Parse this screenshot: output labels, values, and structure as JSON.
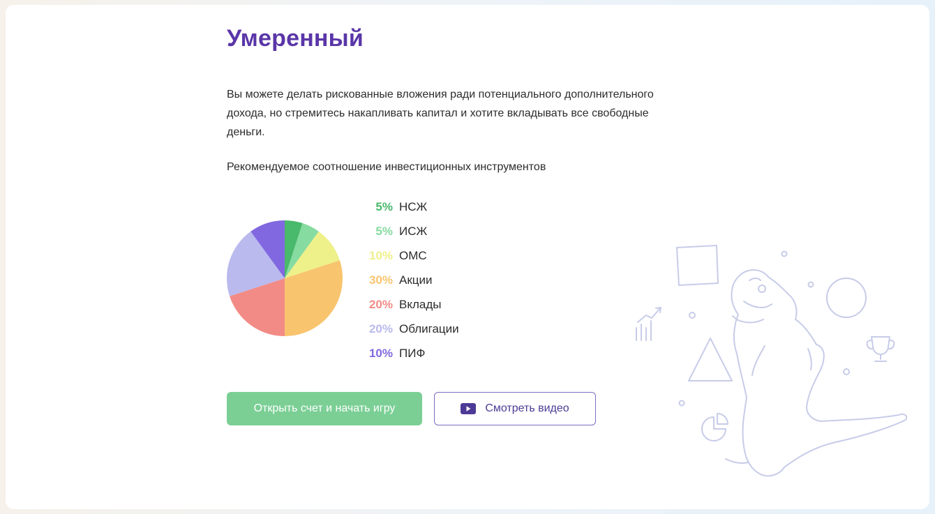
{
  "profile": {
    "title": "Умеренный",
    "description": "Вы можете делать рискованные вложения ради потенциального дополнительного дохода, но стремитесь накапливать капитал и хотите вкладывать все свободные деньги.",
    "subtitle": "Рекомендуемое соотношение инвестиционных инструментов"
  },
  "allocation": [
    {
      "percent": "5%",
      "label": "НСЖ",
      "color": "#49b96b"
    },
    {
      "percent": "5%",
      "label": "ИСЖ",
      "color": "#86dba0"
    },
    {
      "percent": "10%",
      "label": "ОМС",
      "color": "#eef08a"
    },
    {
      "percent": "30%",
      "label": "Акции",
      "color": "#f9c46e"
    },
    {
      "percent": "20%",
      "label": "Вклады",
      "color": "#f28b86"
    },
    {
      "percent": "20%",
      "label": "Облигации",
      "color": "#babaee"
    },
    {
      "percent": "10%",
      "label": "ПИФ",
      "color": "#8168e0"
    }
  ],
  "chart_data": {
    "type": "pie",
    "categories": [
      "НСЖ",
      "ИСЖ",
      "ОМС",
      "Акции",
      "Вклады",
      "Облигации",
      "ПИФ"
    ],
    "values": [
      5,
      5,
      10,
      30,
      20,
      20,
      10
    ],
    "colors": [
      "#49b96b",
      "#86dba0",
      "#eef08a",
      "#f9c46e",
      "#f28b86",
      "#babaee",
      "#8168e0"
    ],
    "legend_placement": "right"
  },
  "actions": {
    "open_account_label": "Открыть счет и начать игру",
    "watch_video_label": "Смотреть видео"
  },
  "icons": {
    "play": "play-icon",
    "illustration": "dinosaur-illustration"
  },
  "theme": {
    "accent": "#5a36a8",
    "primary_button": "#7bcf95",
    "secondary_border": "#7f6bc2"
  }
}
